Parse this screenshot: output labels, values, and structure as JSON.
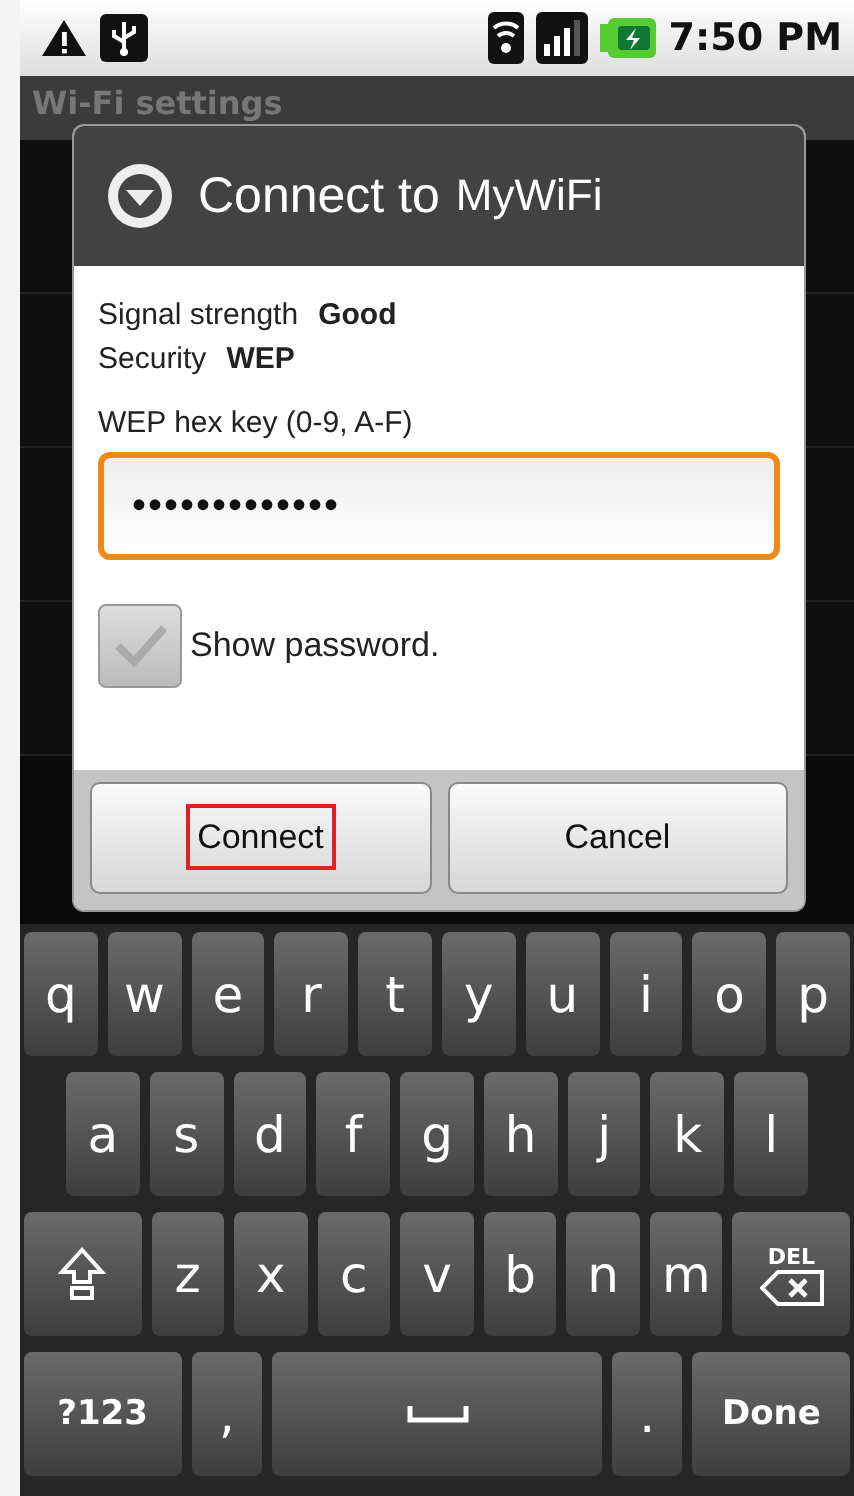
{
  "status_bar": {
    "time": "7:50 PM"
  },
  "screen": {
    "title": "Wi-Fi settings"
  },
  "dialog": {
    "title": "Connect to",
    "network": "MyWiFi",
    "details": [
      {
        "label": "Signal strength",
        "value": "Good"
      },
      {
        "label": "Security",
        "value": "WEP"
      }
    ],
    "password_label": "WEP hex key (0-9, A-F)",
    "password": "•••••••••••••",
    "show_password": {
      "label": "Show password.",
      "checked": false
    },
    "buttons": [
      {
        "label": "Connect",
        "highlighted": true
      },
      {
        "label": "Cancel",
        "highlighted": false
      }
    ]
  },
  "keyboard": {
    "rows": [
      {
        "keys": [
          {
            "kind": "char",
            "label": "q"
          },
          {
            "kind": "char",
            "label": "w"
          },
          {
            "kind": "char",
            "label": "e"
          },
          {
            "kind": "char",
            "label": "r"
          },
          {
            "kind": "char",
            "label": "t"
          },
          {
            "kind": "char",
            "label": "y"
          },
          {
            "kind": "char",
            "label": "u"
          },
          {
            "kind": "char",
            "label": "i"
          },
          {
            "kind": "char",
            "label": "o"
          },
          {
            "kind": "char",
            "label": "p"
          }
        ]
      },
      {
        "keys": [
          {
            "kind": "char",
            "label": "a"
          },
          {
            "kind": "char",
            "label": "s"
          },
          {
            "kind": "char",
            "label": "d"
          },
          {
            "kind": "char",
            "label": "f"
          },
          {
            "kind": "char",
            "label": "g"
          },
          {
            "kind": "char",
            "label": "h"
          },
          {
            "kind": "char",
            "label": "j"
          },
          {
            "kind": "char",
            "label": "k"
          },
          {
            "kind": "char",
            "label": "l"
          }
        ]
      },
      {
        "keys": [
          {
            "kind": "shift"
          },
          {
            "kind": "char",
            "label": "z"
          },
          {
            "kind": "char",
            "label": "x"
          },
          {
            "kind": "char",
            "label": "c"
          },
          {
            "kind": "char",
            "label": "v"
          },
          {
            "kind": "char",
            "label": "b"
          },
          {
            "kind": "char",
            "label": "n"
          },
          {
            "kind": "char",
            "label": "m"
          },
          {
            "kind": "del",
            "label": "DEL"
          }
        ]
      },
      {
        "keys": [
          {
            "kind": "symbols",
            "label": "?123"
          },
          {
            "kind": "char",
            "label": ","
          },
          {
            "kind": "space"
          },
          {
            "kind": "char",
            "label": "."
          },
          {
            "kind": "done",
            "label": "Done"
          }
        ]
      }
    ]
  }
}
